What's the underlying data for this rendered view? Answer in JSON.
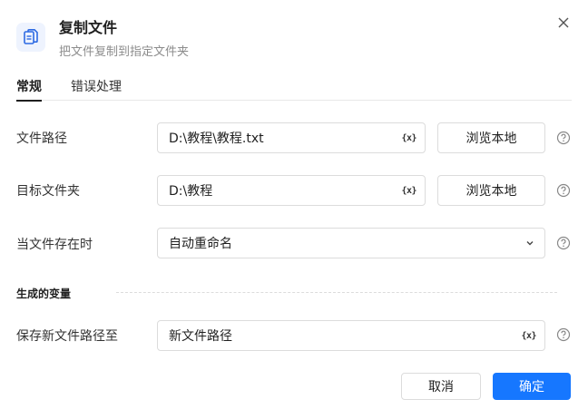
{
  "header": {
    "title": "复制文件",
    "subtitle": "把文件复制到指定文件夹",
    "icon": "file-copy-icon",
    "close_icon": "close-icon"
  },
  "tabs": [
    {
      "label": "常规",
      "active": true
    },
    {
      "label": "错误处理",
      "active": false
    }
  ],
  "form": {
    "file_path": {
      "label": "文件路径",
      "value": "D:\\教程\\教程.txt",
      "variable_icon": "{x}",
      "browse_label": "浏览本地"
    },
    "target_folder": {
      "label": "目标文件夹",
      "value": "D:\\教程",
      "variable_icon": "{x}",
      "browse_label": "浏览本地"
    },
    "when_exists": {
      "label": "当文件存在时",
      "value": "自动重命名"
    }
  },
  "generated_vars": {
    "section_title": "生成的变量",
    "save_path": {
      "label": "保存新文件路径至",
      "value": "新文件路径",
      "variable_icon": "{x}"
    }
  },
  "footer": {
    "cancel_label": "取消",
    "ok_label": "确定"
  },
  "colors": {
    "primary": "#1677ff",
    "icon_bg": "#eef3fe",
    "border": "#dcdcdc"
  }
}
